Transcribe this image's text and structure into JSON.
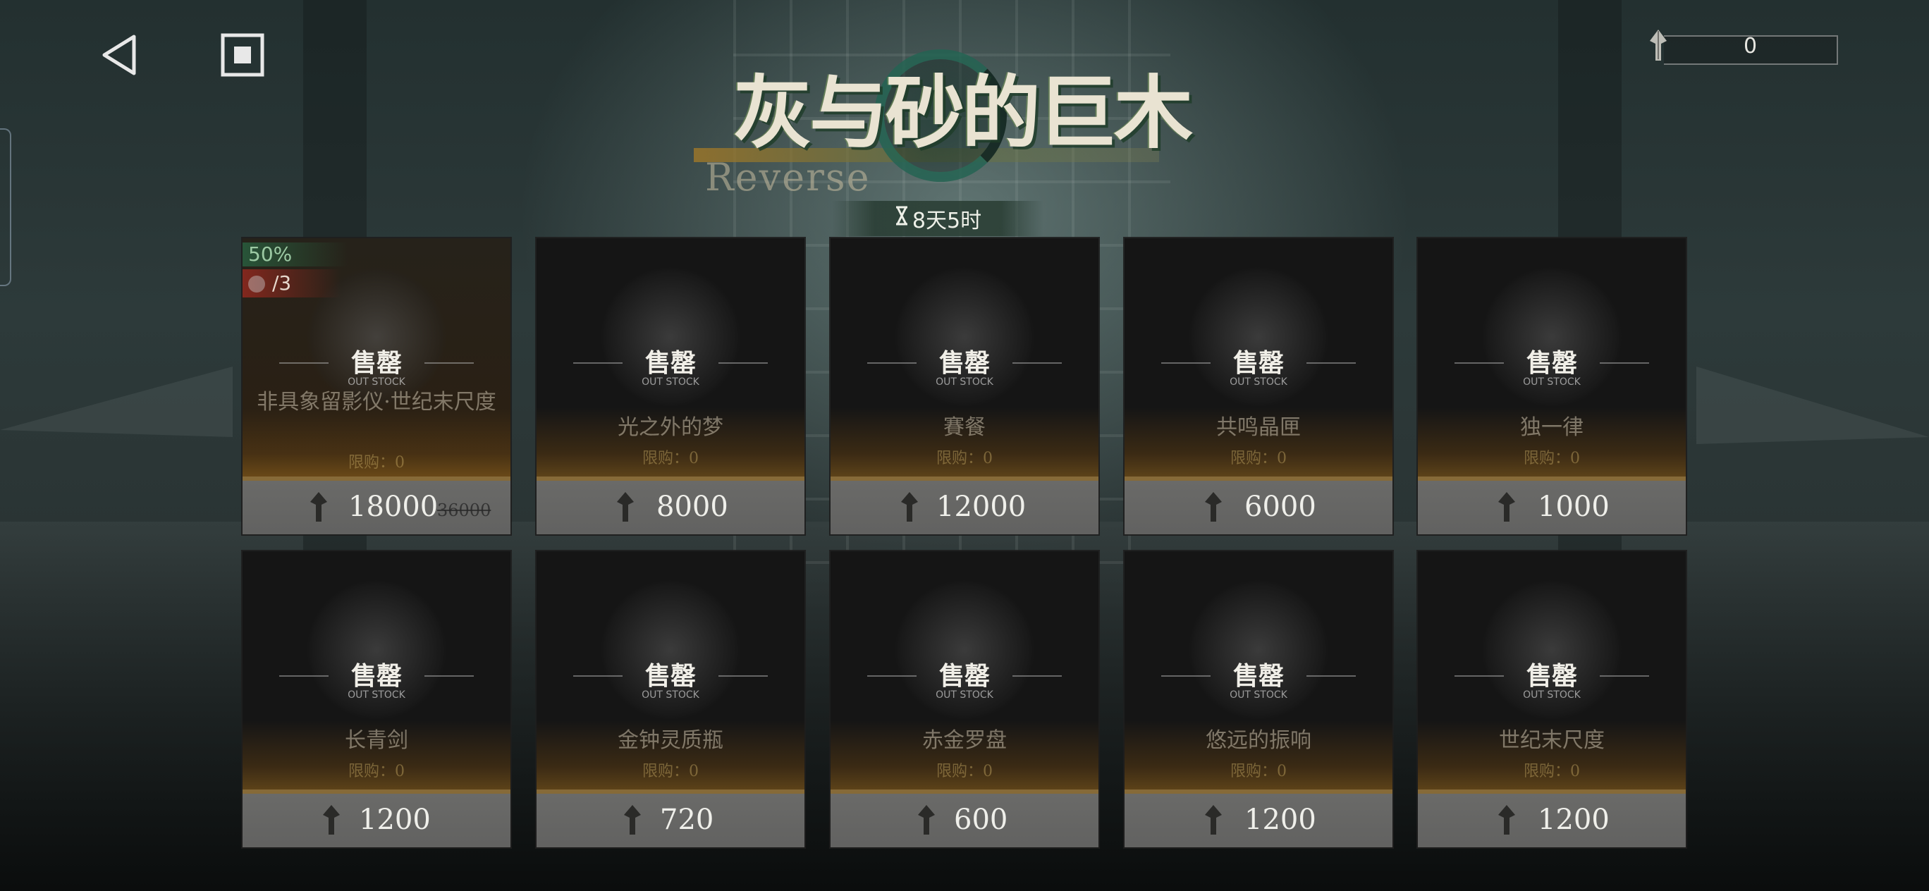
{
  "event": {
    "title": "灰与砂的巨木",
    "subtitle": "Reverse",
    "timer": "8天5时"
  },
  "currency": {
    "amount": "0",
    "icon": "spear-token-icon"
  },
  "shop": {
    "soldout_label": "售罄",
    "soldout_label_en": "OUT STOCK",
    "limit_label": "限购：0",
    "items": [
      {
        "name": "非具象留影仪·世纪末尺度",
        "price": "18000",
        "original_price": "36000",
        "discount": "50%",
        "count": "/3"
      },
      {
        "name": "光之外的梦",
        "price": "8000"
      },
      {
        "name": "賽餐",
        "price": "12000"
      },
      {
        "name": "共鸣晶匣",
        "price": "6000"
      },
      {
        "name": "独一律",
        "price": "1000"
      },
      {
        "name": "长青剑",
        "price": "1200"
      },
      {
        "name": "金钟灵质瓶",
        "price": "720"
      },
      {
        "name": "赤金罗盘",
        "price": "600"
      },
      {
        "name": "悠远的振响",
        "price": "1200"
      },
      {
        "name": "世纪末尺度",
        "price": "1200"
      }
    ]
  },
  "colors": {
    "accent_gold": "#a06e28",
    "discount_green": "#2f6a48",
    "count_red": "#8c281e"
  }
}
